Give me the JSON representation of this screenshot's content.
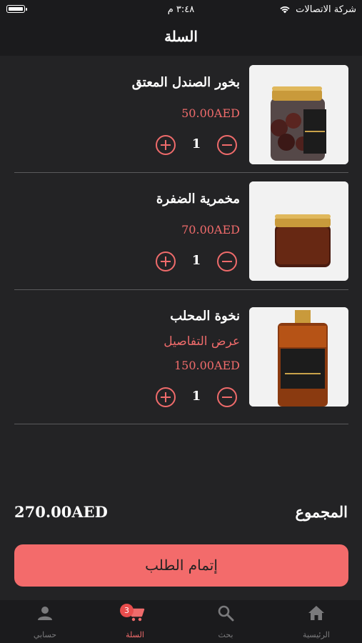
{
  "status_bar": {
    "time": "٣:٤٨ م",
    "carrier": "شركة الاتصالات"
  },
  "header": {
    "title": "السلة"
  },
  "cart": {
    "items": [
      {
        "name": "بخور الصندل المعتق",
        "price": "50.00AED",
        "quantity": "1"
      },
      {
        "name": "مخمرية الضفرة",
        "price": "70.00AED",
        "quantity": "1"
      },
      {
        "name": "نخوة المحلب",
        "details_link": "عرض التفاصيل",
        "price": "150.00AED",
        "quantity": "1"
      }
    ]
  },
  "summary": {
    "total_label": "المجموع",
    "total_value": "270.00AED"
  },
  "checkout": {
    "label": "إتمام الطلب"
  },
  "tab_bar": {
    "tabs": [
      {
        "label": "حسابي",
        "icon": "person-icon"
      },
      {
        "label": "السلة",
        "icon": "cart-icon",
        "badge": "3"
      },
      {
        "label": "بحث",
        "icon": "search-icon"
      },
      {
        "label": "الرئيسية",
        "icon": "home-icon"
      }
    ]
  },
  "colors": {
    "accent": "#f36b6b",
    "background": "#232325",
    "bar": "#1b1b1d"
  }
}
